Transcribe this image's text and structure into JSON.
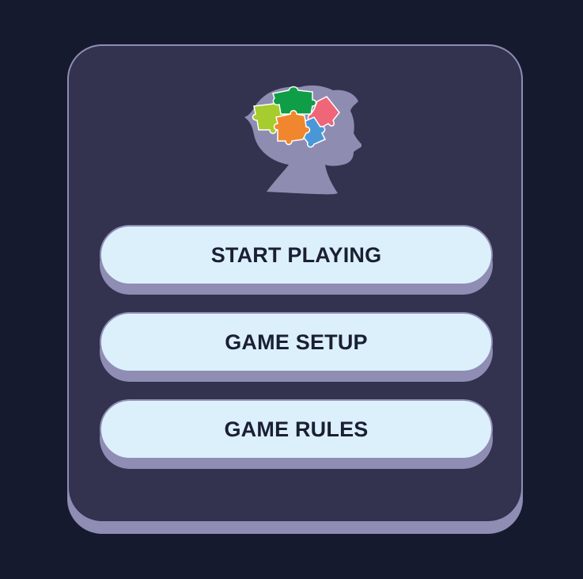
{
  "colors": {
    "background": "#161a2f",
    "card": "#33324f",
    "card_border": "#8f8db3",
    "button": "#dcf0fc",
    "button_text": "#1b1f33"
  },
  "logo": {
    "icon": "head-with-puzzle-pieces-icon"
  },
  "menu": {
    "start_label": "START PLAYING",
    "setup_label": "GAME SETUP",
    "rules_label": "GAME RULES"
  }
}
